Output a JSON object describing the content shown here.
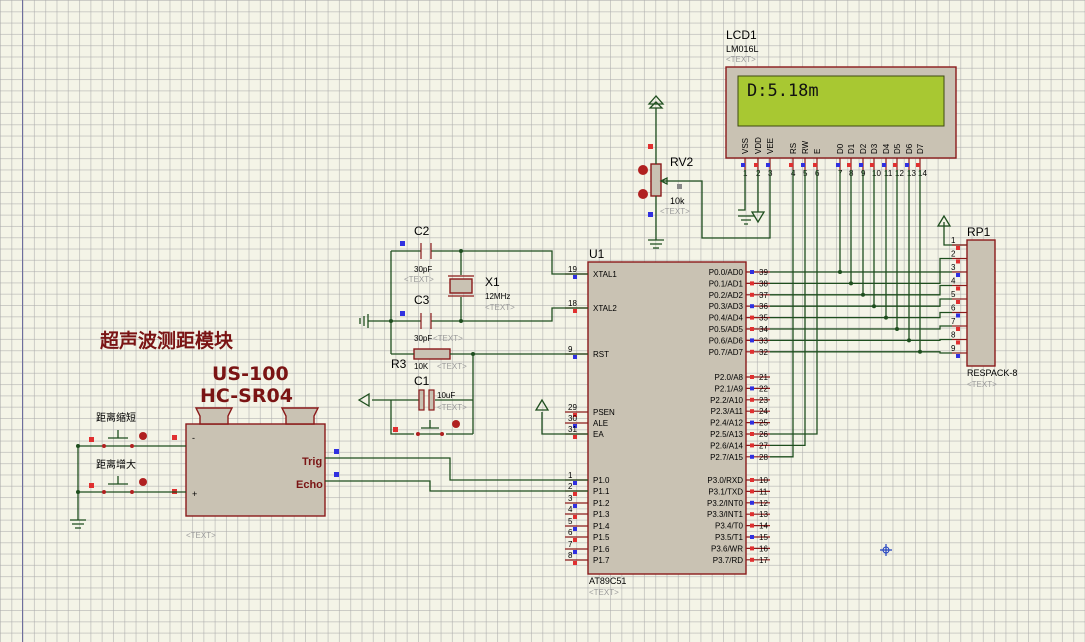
{
  "title_cn": "超声波测距模块",
  "module_name1": "US-100",
  "module_name2": "HC-SR04",
  "text_placeholder": "<TEXT>",
  "lcd": {
    "ref": "LCD1",
    "model": "LM016L",
    "display": "D:5.18m",
    "pins": [
      "VSS",
      "VDD",
      "VEE",
      "RS",
      "RW",
      "E",
      "D0",
      "D1",
      "D2",
      "D3",
      "D4",
      "D5",
      "D6",
      "D7"
    ],
    "pin_numbers": [
      "1",
      "2",
      "3",
      "4",
      "5",
      "6",
      "7",
      "8",
      "9",
      "10",
      "11",
      "12",
      "13",
      "14"
    ]
  },
  "rv2": {
    "ref": "RV2",
    "value": "10k"
  },
  "rp1": {
    "ref": "RP1",
    "model": "RESPACK-8",
    "pins": [
      "1",
      "2",
      "3",
      "4",
      "5",
      "6",
      "7",
      "8",
      "9"
    ]
  },
  "c2": {
    "ref": "C2",
    "value": "30pF"
  },
  "c3": {
    "ref": "C3",
    "value": "30pF"
  },
  "x1": {
    "ref": "X1",
    "value": "12MHz"
  },
  "r3": {
    "ref": "R3",
    "value": "10K"
  },
  "c1": {
    "ref": "C1",
    "value": "10uF"
  },
  "btn1": "距离缩短",
  "btn2": "距离增大",
  "sensor": {
    "trig": "Trig",
    "echo": "Echo",
    "minus": "-",
    "plus": "+"
  },
  "u1": {
    "ref": "U1",
    "model": "AT89C51",
    "left_pins": [
      {
        "num": "19",
        "name": "XTAL1"
      },
      {
        "num": "18",
        "name": "XTAL2"
      },
      {
        "num": "9",
        "name": "RST"
      },
      {
        "num": "29",
        "name": "PSEN"
      },
      {
        "num": "30",
        "name": "ALE"
      },
      {
        "num": "31",
        "name": "EA"
      },
      {
        "num": "1",
        "name": "P1.0"
      },
      {
        "num": "2",
        "name": "P1.1"
      },
      {
        "num": "3",
        "name": "P1.2"
      },
      {
        "num": "4",
        "name": "P1.3"
      },
      {
        "num": "5",
        "name": "P1.4"
      },
      {
        "num": "6",
        "name": "P1.5"
      },
      {
        "num": "7",
        "name": "P1.6"
      },
      {
        "num": "8",
        "name": "P1.7"
      }
    ],
    "right_pins": [
      {
        "num": "39",
        "name": "P0.0/AD0"
      },
      {
        "num": "38",
        "name": "P0.1/AD1"
      },
      {
        "num": "37",
        "name": "P0.2/AD2"
      },
      {
        "num": "36",
        "name": "P0.3/AD3"
      },
      {
        "num": "35",
        "name": "P0.4/AD4"
      },
      {
        "num": "34",
        "name": "P0.5/AD5"
      },
      {
        "num": "33",
        "name": "P0.6/AD6"
      },
      {
        "num": "32",
        "name": "P0.7/AD7"
      },
      {
        "num": "21",
        "name": "P2.0/A8"
      },
      {
        "num": "22",
        "name": "P2.1/A9"
      },
      {
        "num": "23",
        "name": "P2.2/A10"
      },
      {
        "num": "24",
        "name": "P2.3/A11"
      },
      {
        "num": "25",
        "name": "P2.4/A12"
      },
      {
        "num": "26",
        "name": "P2.5/A13"
      },
      {
        "num": "27",
        "name": "P2.6/A14"
      },
      {
        "num": "28",
        "name": "P2.7/A15"
      },
      {
        "num": "10",
        "name": "P3.0/RXD"
      },
      {
        "num": "11",
        "name": "P3.1/TXD"
      },
      {
        "num": "12",
        "name": "P3.2/INT0"
      },
      {
        "num": "13",
        "name": "P3.3/INT1"
      },
      {
        "num": "14",
        "name": "P3.4/T0"
      },
      {
        "num": "15",
        "name": "P3.5/T1"
      },
      {
        "num": "16",
        "name": "P3.6/WR"
      },
      {
        "num": "17",
        "name": "P3.7/RD"
      }
    ]
  }
}
